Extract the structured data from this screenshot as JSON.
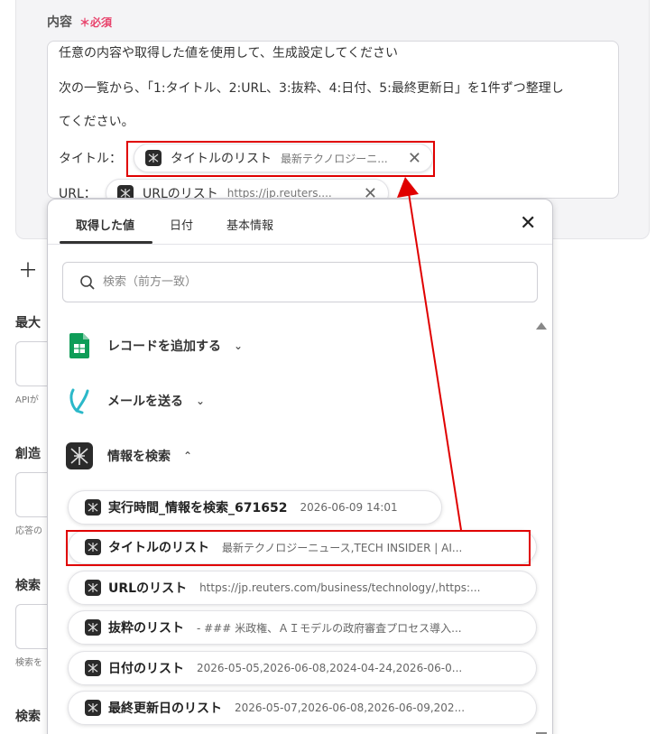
{
  "field": {
    "label": "内容",
    "required_mark": "＊",
    "required_text": "必須"
  },
  "editor": {
    "lines": [
      "任意の内容や取得した値を使用して、生成設定してください",
      "次の一覧から、「1:タイトル、2:URL、3:抜粋、4:日付、5:最終更新日」を1件ずつ整理し",
      "てください。"
    ],
    "title_prefix": "タイトル：",
    "url_prefix": "URL：",
    "chips": [
      {
        "label": "タイトルのリスト",
        "value": "最新テクノロジーニ...",
        "icon": "app-icon"
      },
      {
        "label": "URLのリスト",
        "value": "https://jp.reuters....",
        "icon": "app-icon"
      }
    ]
  },
  "left_fragments": {
    "max": "最大",
    "api_hint": "APIが",
    "creativity": "創造",
    "answer_hint": "応答の",
    "search": "検索",
    "search_hint": "検索を",
    "search2": "検索"
  },
  "panel": {
    "tabs": [
      "取得した値",
      "日付",
      "基本情報"
    ],
    "active_tab": "取得した値",
    "search_placeholder": "検索（前方一致）",
    "sections": [
      {
        "title": "レコードを追加する",
        "icon": "sheets-icon",
        "expanded": false
      },
      {
        "title": "メールを送る",
        "icon": "mail-icon",
        "expanded": false
      },
      {
        "title": "情報を検索",
        "icon": "app-icon",
        "expanded": true
      }
    ],
    "items": [
      {
        "label": "実行時間_情報を検索_671652",
        "value": "2026-06-09 14:01"
      },
      {
        "label": "タイトルのリスト",
        "value": "最新テクノロジーニュース,TECH INSIDER | AI..."
      },
      {
        "label": "URLのリスト",
        "value": "https://jp.reuters.com/business/technology/,https:..."
      },
      {
        "label": "抜粋のリスト",
        "value": "- ### 米政権、ＡＩモデルの政府審査プロセス導入..."
      },
      {
        "label": "日付のリスト",
        "value": "2026-05-05,2026-06-08,2024-04-24,2026-06-0..."
      },
      {
        "label": "最終更新日のリスト",
        "value": "2026-05-07,2026-06-08,2026-06-09,202..."
      }
    ]
  },
  "colors": {
    "highlight": "#e00000",
    "required": "#e8426b",
    "sheets_green": "#0f9d58",
    "mail_teal": "#2bb8c9"
  }
}
